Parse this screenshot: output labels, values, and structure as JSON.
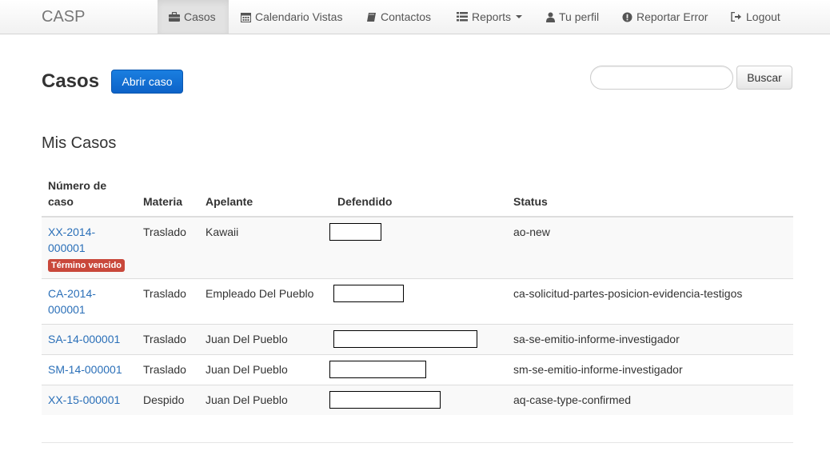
{
  "navbar": {
    "brand": "CASP",
    "items": [
      {
        "label": "Casos",
        "icon": "briefcase-icon",
        "active": true
      },
      {
        "label": "Calendario Vistas",
        "icon": "calendar-icon"
      },
      {
        "label": "Contactos",
        "icon": "book-icon"
      },
      {
        "label": "Reports",
        "icon": "list-icon"
      },
      {
        "label": "Tu perfil",
        "icon": "user-icon"
      },
      {
        "label": "Reportar Error",
        "icon": "exclamation-circle-icon"
      },
      {
        "label": "Logout",
        "icon": "logout-icon"
      }
    ]
  },
  "page": {
    "title": "Casos",
    "open_case_label": "Abrir caso"
  },
  "search": {
    "value": "",
    "placeholder": "",
    "button_label": "Buscar"
  },
  "cases": {
    "title": "Mis Casos",
    "headers": [
      "Número de caso",
      "Materia",
      "Apelante",
      "Defendido",
      "Status"
    ],
    "rows": [
      {
        "number_line1": "XX-2014-",
        "number_line2": "000001",
        "badge": "Término vencido",
        "materia": "Traslado",
        "apelante": "Kawaii",
        "status": "ao-new"
      },
      {
        "number_line1": "CA-2014-",
        "number_line2": "000001",
        "materia": "Traslado",
        "apelante": "Empleado Del Pueblo",
        "status": "ca-solicitud-partes-posicion-evidencia-testigos"
      },
      {
        "number_line1": "SA-14-000001",
        "materia": "Traslado",
        "apelante": "Juan Del Pueblo",
        "status": "sa-se-emitio-informe-investigador"
      },
      {
        "number_line1": "SM-14-000001",
        "materia": "Traslado",
        "apelante": "Juan Del Pueblo",
        "status": "sm-se-emitio-informe-investigador"
      },
      {
        "number_line1": "XX-15-000001",
        "materia": "Despido",
        "apelante": "Juan Del Pueblo",
        "status": "aq-case-type-confirmed"
      }
    ]
  },
  "colors": {
    "link": "#2a6fb8",
    "primary_button": "#0d63c8",
    "danger_badge": "#c9483b"
  }
}
